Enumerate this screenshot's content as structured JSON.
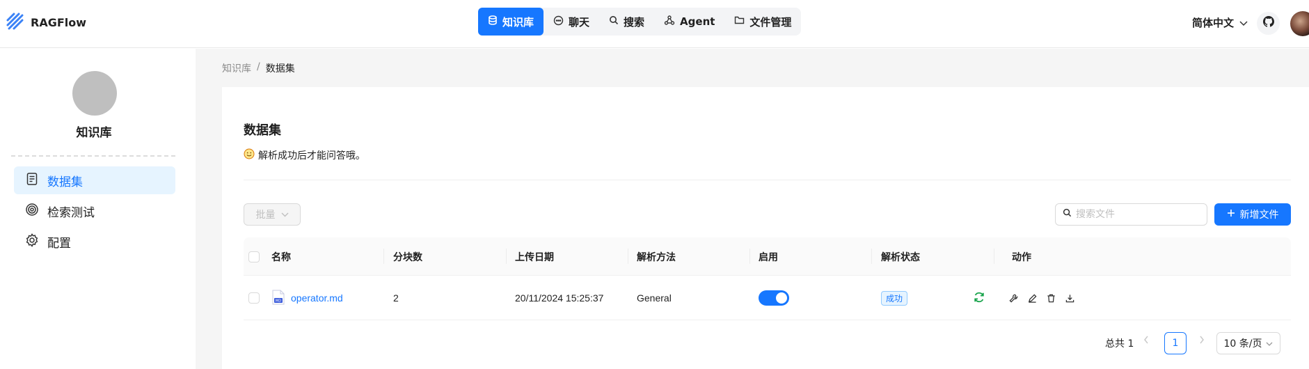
{
  "app": {
    "name": "RAGFlow"
  },
  "nav": {
    "items": [
      {
        "label": "知识库",
        "icon": "database-icon",
        "active": true
      },
      {
        "label": "聊天",
        "icon": "chat-bubble-icon"
      },
      {
        "label": "搜索",
        "icon": "search-icon"
      },
      {
        "label": "Agent",
        "icon": "agent-graph-icon"
      },
      {
        "label": "文件管理",
        "icon": "folder-icon"
      }
    ]
  },
  "header": {
    "language": "简体中文",
    "accent": "#1677ff"
  },
  "sidebar": {
    "kb_name": "知识库",
    "items": [
      {
        "label": "数据集",
        "icon": "document-icon",
        "active": true
      },
      {
        "label": "检索测试",
        "icon": "target-icon"
      },
      {
        "label": "配置",
        "icon": "gear-icon"
      }
    ]
  },
  "breadcrumb": {
    "parent": "知识库",
    "separator": "/",
    "current": "数据集"
  },
  "dataset": {
    "title": "数据集",
    "tip": "解析成功后才能问答哦。",
    "batch_label": "批量",
    "search_placeholder": "搜索文件",
    "add_label": "新增文件",
    "columns": [
      "名称",
      "分块数",
      "上传日期",
      "解析方法",
      "启用",
      "解析状态",
      "动作"
    ],
    "rows": [
      {
        "name": "operator.md",
        "file_icon": "markdown-file-icon",
        "chunks": "2",
        "upload_date": "20/11/2024 15:25:37",
        "parse_method": "General",
        "enabled": true,
        "status": "成功"
      }
    ]
  },
  "pagination": {
    "total_label": "总共 1",
    "current_page": "1",
    "page_size": "10 条/页"
  }
}
